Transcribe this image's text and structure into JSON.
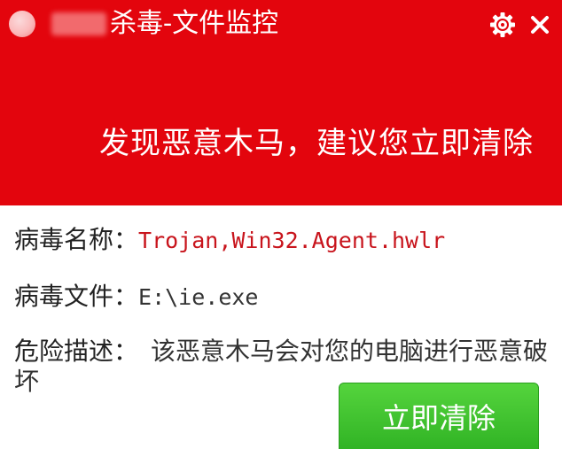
{
  "window": {
    "title": "杀毒-文件监控",
    "icons": {
      "logo": "app-logo-icon",
      "settings": "gear-icon",
      "close": "close-icon"
    }
  },
  "alert": {
    "headline": "发现恶意木马，建议您立即清除"
  },
  "details": {
    "virus_name_label": "病毒名称：",
    "virus_name_value": "Trojan,Win32.Agent.hwlr",
    "virus_file_label": "病毒文件：",
    "virus_file_value": "E:\\ie.exe",
    "risk_label": "危险描述：",
    "risk_value": "该恶意木马会对您的电脑进行恶意破坏"
  },
  "actions": {
    "clean_now_label": "立即清除"
  },
  "colors": {
    "header_red": "#e3050d",
    "value_red": "#c8141c",
    "button_green": "#3cc12e"
  }
}
